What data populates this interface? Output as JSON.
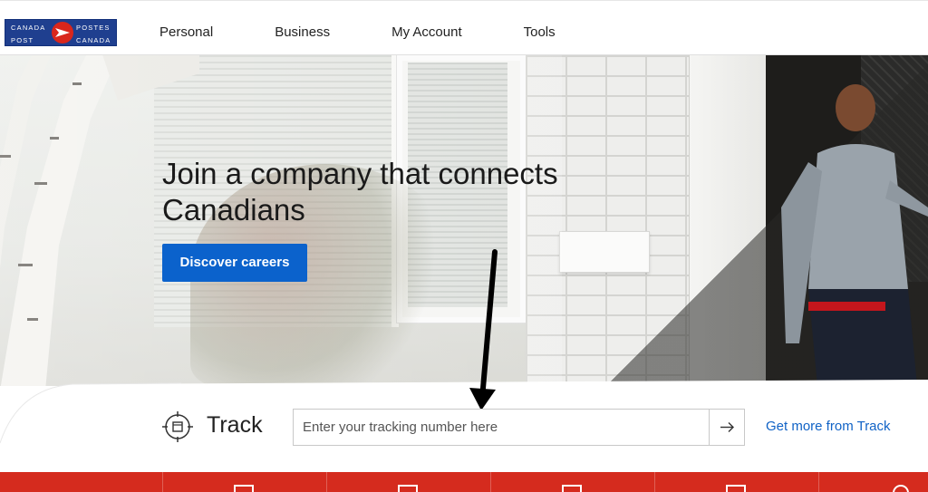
{
  "brand": {
    "logo_text_top_left": "CANADA",
    "logo_text_bottom_left": "POST",
    "logo_text_top_right": "POSTES",
    "logo_text_bottom_right": "CANADA",
    "roundel_color": "#d9261c",
    "logo_bg_color": "#1f3f8f"
  },
  "nav": {
    "items": [
      {
        "label": "Personal"
      },
      {
        "label": "Business"
      },
      {
        "label": "My Account"
      },
      {
        "label": "Tools"
      }
    ]
  },
  "hero": {
    "title_line1": "Join a company that connects",
    "title_line2": "Canadians",
    "cta_label": "Discover careers",
    "cta_color": "#0b62cc"
  },
  "track": {
    "label": "Track",
    "input_placeholder": "Enter your tracking number here",
    "input_value": "",
    "more_link": "Get more from Track",
    "go_icon": "arrow-right-icon"
  },
  "red_bar": {
    "color": "#d52b1e",
    "icons": [
      "tile-icon-1",
      "tile-icon-2",
      "tile-icon-3",
      "tile-icon-4",
      "tile-icon-5"
    ]
  }
}
